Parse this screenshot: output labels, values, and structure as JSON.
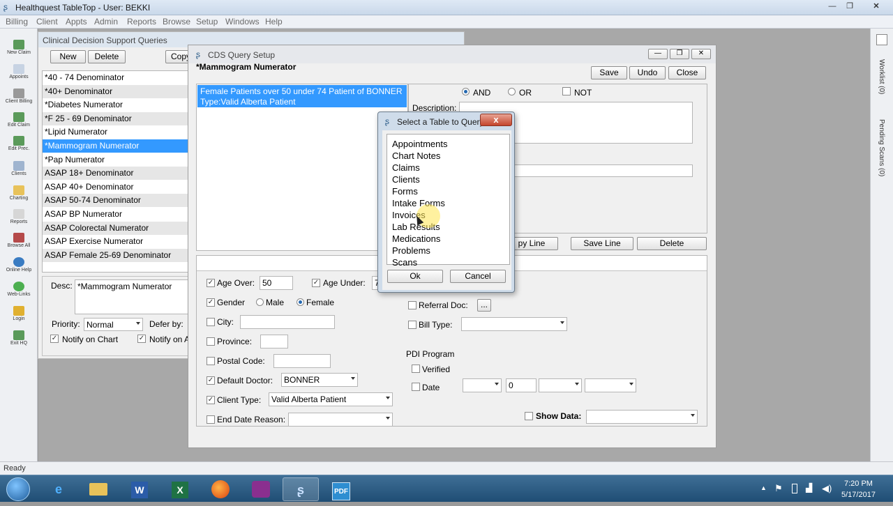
{
  "app": {
    "title": "Healthquest TableTop - User: BEKKI"
  },
  "menu": [
    "Billing",
    "Client",
    "Appts",
    "Admin",
    "Reports",
    "Browse",
    "Setup",
    "Windows",
    "Help"
  ],
  "leftbar": [
    "New Claim",
    "Appoints",
    "Client Billing",
    "Edit Claim",
    "Edit Prec.",
    "Clients",
    "Charting",
    "Reports",
    "Browse All",
    "Online Help",
    "Web-Links",
    "Login",
    "Exit HQ"
  ],
  "rightbar": [
    "Worklist (0)",
    "Pending Scans (0)"
  ],
  "cds": {
    "title": "Clinical Decision Support Queries",
    "new_label": "New",
    "delete_label": "Delete",
    "copy_label": "Copy",
    "queries": [
      "*40 - 74 Denominator",
      "*40+ Denominator",
      "*Diabetes Numerator",
      "*F 25 - 69 Denominator",
      "*Lipid Numerator",
      "*Mammogram Numerator",
      "*Pap Numerator",
      "ASAP 18+ Denominator",
      "ASAP 40+ Denominator",
      "ASAP 50-74 Denominator",
      "ASAP BP Numerator",
      "ASAP Colorectal Numerator",
      "ASAP Exercise Numerator",
      "ASAP Female 25-69 Denominator"
    ],
    "selected_index": 5,
    "desc_label": "Desc:",
    "desc_value": "*Mammogram Numerator",
    "priority_label": "Priority:",
    "priority_value": "Normal",
    "defer_label": "Defer by:",
    "notify_chart": "Notify on Chart",
    "notify_a": "Notify on A"
  },
  "query": {
    "window_title": "CDS Query Setup",
    "name": "*Mammogram Numerator",
    "save_label": "Save",
    "undo_label": "Undo",
    "close_label": "Close",
    "rule_text_1": "Female Patients over 50 under 74 Patient of BONNER",
    "rule_text_2": "Type:Valid Alberta Patient",
    "and_label": "AND",
    "or_label": "OR",
    "not_label": "NOT",
    "description_label": "Description:",
    "copy_line_label": "py Line",
    "save_line_label": "Save Line",
    "delete_label": "Delete",
    "age_over_label": "Age Over:",
    "age_over_value": "50",
    "age_under_label": "Age Under:",
    "age_under_value": "7",
    "gender_label": "Gender",
    "male_label": "Male",
    "female_label": "Female",
    "city_label": "City:",
    "province_label": "Province:",
    "postal_label": "Postal Code:",
    "default_doctor_label": "Default Doctor:",
    "default_doctor_value": "BONNER",
    "client_type_label": "Client Type:",
    "client_type_value": "Valid Alberta Patient",
    "end_date_label": "End Date Reason:",
    "referral_label": "Referral Doc:",
    "referral_btn": "...",
    "bill_type_label": "Bill Type:",
    "pdi_label": "PDI Program",
    "verified_label": "Verified",
    "date_label": "Date",
    "date_num": "0",
    "show_data_label": "Show Data:"
  },
  "dialog": {
    "title": "Select a Table to Query",
    "close_glyph": "x",
    "tables": [
      "Appointments",
      "Chart Notes",
      "Claims",
      "Clients",
      "Forms",
      "Intake Forms",
      "Invoices",
      "Lab Results",
      "Medications",
      "Problems",
      "Scans"
    ],
    "ok_label": "Ok",
    "cancel_label": "Cancel"
  },
  "status": {
    "text": "Ready"
  },
  "tray": {
    "time": "7:20 PM",
    "date": "5/17/2017"
  }
}
